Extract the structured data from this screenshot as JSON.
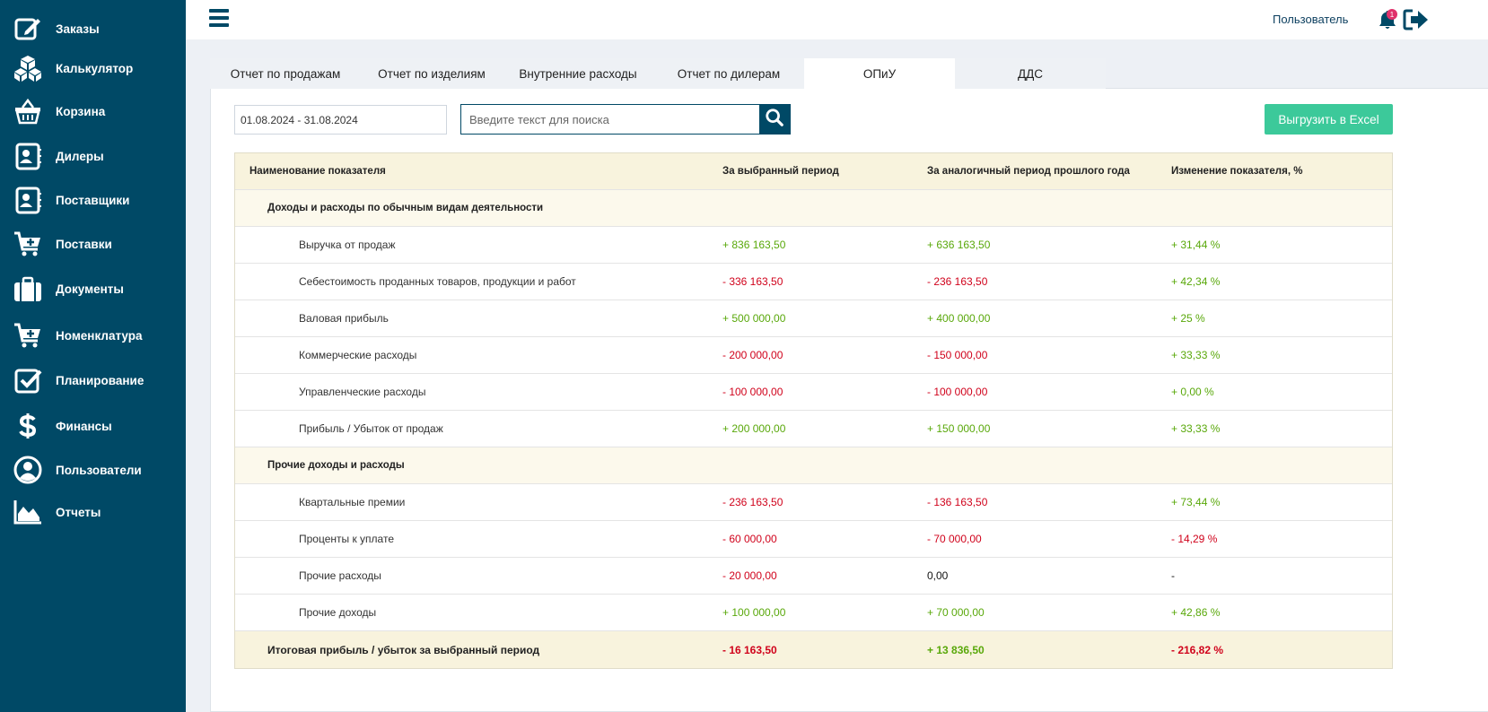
{
  "sidebar": {
    "items": [
      {
        "label": "Заказы",
        "icon": "edit-icon"
      },
      {
        "label": "Калькулятор",
        "icon": "boxes-icon"
      },
      {
        "label": "Корзина",
        "icon": "basket-icon"
      },
      {
        "label": "Дилеры",
        "icon": "contact-card-icon"
      },
      {
        "label": "Поставщики",
        "icon": "contact-card-icon"
      },
      {
        "label": "Поставки",
        "icon": "cart-plus-icon"
      },
      {
        "label": "Документы",
        "icon": "briefcase-icon"
      },
      {
        "label": "Номенклатура",
        "icon": "cart-plus-icon"
      },
      {
        "label": "Планирование",
        "icon": "checkbox-icon"
      },
      {
        "label": "Финансы",
        "icon": "dollar-icon"
      },
      {
        "label": "Пользователи",
        "icon": "user-circle-icon"
      },
      {
        "label": "Отчеты",
        "icon": "area-chart-icon"
      }
    ]
  },
  "header": {
    "user_label": "Пользователь",
    "notification_count": "1"
  },
  "tabs": [
    {
      "label": "Отчет по продажам",
      "active": false
    },
    {
      "label": "Отчет по изделиям",
      "active": false
    },
    {
      "label": "Внутренние расходы",
      "active": false
    },
    {
      "label": "Отчет по дилерам",
      "active": false
    },
    {
      "label": "ОПиУ",
      "active": true
    },
    {
      "label": "ДДС",
      "active": false
    }
  ],
  "filters": {
    "date_range": "01.08.2024 - 31.08.2024",
    "search_placeholder": "Введите текст для поиска",
    "export_label": "Выгрузить в Excel"
  },
  "table": {
    "columns": [
      "Наименование показателя",
      "За выбранный период",
      "За аналогичный период прошлого года",
      "Изменение показателя, %"
    ],
    "rows": [
      {
        "type": "group",
        "name": "Доходы и расходы по обычным видам деятельности"
      },
      {
        "type": "item",
        "name": "Выручка от продаж",
        "cur": "+ 836 163,50",
        "prev": "+ 636 163,50",
        "chg": "+ 31,44 %"
      },
      {
        "type": "item",
        "name": "Себестоимость проданных товаров, продукции и работ",
        "cur": "- 336 163,50",
        "prev": "- 236 163,50",
        "chg": "+ 42,34 %"
      },
      {
        "type": "item",
        "name": "Валовая прибыль",
        "cur": "+ 500 000,00",
        "prev": "+ 400 000,00",
        "chg": "+ 25 %"
      },
      {
        "type": "item",
        "name": "Коммерческие расходы",
        "cur": "- 200 000,00",
        "prev": "- 150 000,00",
        "chg": "+ 33,33 %"
      },
      {
        "type": "item",
        "name": "Управленческие расходы",
        "cur": "- 100 000,00",
        "prev": "- 100 000,00",
        "chg": "+ 0,00 %"
      },
      {
        "type": "item",
        "name": "Прибыль / Убыток от продаж",
        "cur": "+ 200 000,00",
        "prev": "+ 150 000,00",
        "chg": "+ 33,33 %"
      },
      {
        "type": "group",
        "name": "Прочие доходы и расходы"
      },
      {
        "type": "item",
        "name": "Квартальные премии",
        "cur": "- 236 163,50",
        "prev": "- 136 163,50",
        "chg": "+ 73,44 %"
      },
      {
        "type": "item",
        "name": "Проценты к уплате",
        "cur": "- 60 000,00",
        "prev": "- 70 000,00",
        "chg": "- 14,29 %"
      },
      {
        "type": "item",
        "name": "Прочие расходы",
        "cur": "- 20 000,00",
        "prev": "0,00",
        "chg": "-"
      },
      {
        "type": "item",
        "name": "Прочие доходы",
        "cur": "+ 100 000,00",
        "prev": "+ 70 000,00",
        "chg": "+ 42,86 %"
      },
      {
        "type": "total",
        "name": "Итоговая прибыль / убыток за выбранный период",
        "cur": "- 16 163,50",
        "prev": "+ 13 836,50",
        "chg": "- 216,82 %"
      }
    ]
  },
  "colors": {
    "sidebar_bg": "#004966",
    "positive": "#59a80a",
    "negative": "#d0021b",
    "export_button": "#3cc99a"
  }
}
